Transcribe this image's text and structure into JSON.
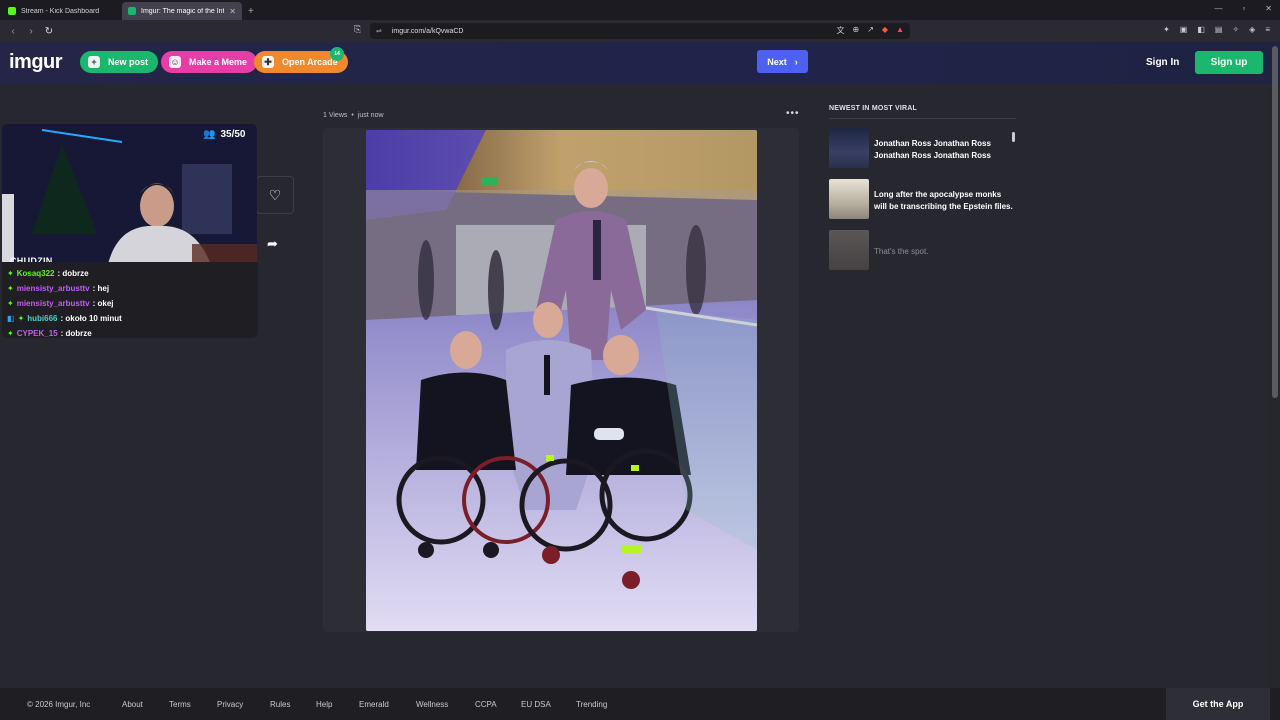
{
  "browser": {
    "tabs": [
      {
        "title": "Stream - Kick Dashboard",
        "icon_color": "#53fc18"
      },
      {
        "title": "Imgur: The magic of the Internet",
        "icon_color": "#1bb76e"
      }
    ],
    "url": "imgur.com/a/kQvwaCD"
  },
  "header": {
    "logo": "imgur",
    "new_post": "New post",
    "make_meme": "Make a Meme",
    "open_arcade": "Open Arcade",
    "arcade_badge": "14",
    "next": "Next",
    "sign_in": "Sign In",
    "sign_up": "Sign up"
  },
  "post": {
    "views": "1 Views",
    "time": "just now"
  },
  "sidebar": {
    "title": "NEWEST IN MOST VIRAL",
    "items": [
      {
        "title": "Jonathan Ross Jonathan Ross Jonathan Ross Jonathan Ross"
      },
      {
        "title": "Long after the apocalypse monks will be transcribing the Epstein files."
      },
      {
        "title": "That's the spot."
      }
    ]
  },
  "stream": {
    "viewers": "35/50",
    "streamer": "CHUDZIN",
    "chat": [
      {
        "user": "Kosaq322",
        "msg": ": dobrze",
        "color": "#53fc18"
      },
      {
        "user": "miensisty_arbusttv",
        "msg": ": hej",
        "color": "#c45cf0"
      },
      {
        "user": "miensisty_arbusttv",
        "msg": ": okej",
        "color": "#c45cf0"
      },
      {
        "user": "hubi666",
        "msg": ": około 10 minut",
        "color": "#41d0c6"
      },
      {
        "user": "CYPEK_15",
        "msg": ": dobrze",
        "color": "#c45cf0"
      }
    ]
  },
  "footer": {
    "links": [
      "© 2026 Imgur, Inc",
      "About",
      "Terms",
      "Privacy",
      "Rules",
      "Help",
      "Emerald",
      "Wellness",
      "CCPA",
      "EU DSA",
      "Trending"
    ],
    "get_app": "Get the App"
  }
}
